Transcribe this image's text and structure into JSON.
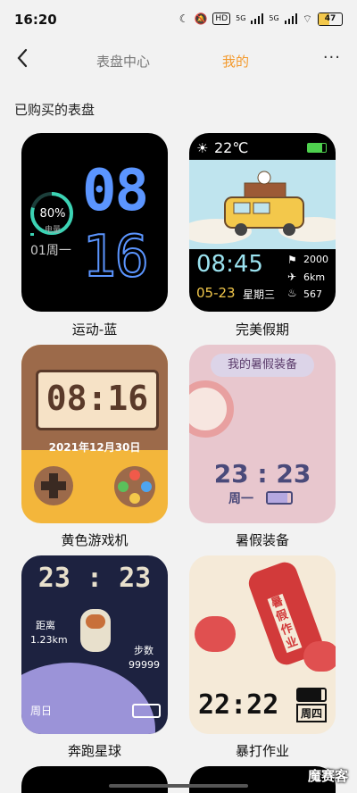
{
  "status_bar": {
    "time": "16:20",
    "network1": "5G",
    "network2": "5G",
    "hd": "HD",
    "battery": "47",
    "battery_level": 0.47
  },
  "nav": {
    "back": "<",
    "tab_center": "表盘中心",
    "tab_mine": "我的",
    "more": "···"
  },
  "section_title": "已购买的表盘",
  "faces": [
    {
      "name": "运动-蓝",
      "percent": "80%",
      "battery_label": "电量",
      "date": "01周一",
      "hour": "08",
      "minute": "16"
    },
    {
      "name": "完美假期",
      "temp": "22℃",
      "time": "08:45",
      "date": "05-23",
      "weekday": "星期三",
      "steps": "2000",
      "distance": "6km",
      "calories": "567"
    },
    {
      "name": "黄色游戏机",
      "time": "08:16",
      "date": "2021年12月30日"
    },
    {
      "name": "暑假装备",
      "banner": "我的暑假装备",
      "time": "23 : 23",
      "weekday": "周一"
    },
    {
      "name": "奔跑星球",
      "time": "23 : 23",
      "distance_label": "距离",
      "distance": "1.23km",
      "steps_label": "步数",
      "steps": "99999",
      "weekday": "周日"
    },
    {
      "name": "暴打作业",
      "time": "22:22",
      "weekday": "周四",
      "bottle_text": "暑假作业"
    }
  ],
  "watermark": "魔赛客"
}
